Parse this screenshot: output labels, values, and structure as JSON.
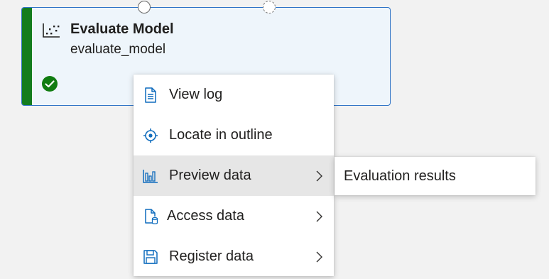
{
  "node": {
    "title": "Evaluate Model",
    "subtitle": "evaluate_model",
    "icon": "scatter-plot-icon",
    "status": "completed",
    "status_icon": "check-circle-icon",
    "status_color": "#137c1e",
    "accent_color": "#2e73c6"
  },
  "context_menu": {
    "items": [
      {
        "label": "View log",
        "icon": "document-icon",
        "has_submenu": false
      },
      {
        "label": "Locate in outline",
        "icon": "locate-icon",
        "has_submenu": false
      },
      {
        "label": "Preview data",
        "icon": "bar-chart-icon",
        "has_submenu": true,
        "active": true
      },
      {
        "label": "Access data",
        "icon": "document-database-icon",
        "has_submenu": true
      },
      {
        "label": "Register data",
        "icon": "save-icon",
        "has_submenu": true
      }
    ]
  },
  "submenu": {
    "items": [
      {
        "label": "Evaluation results"
      }
    ]
  }
}
